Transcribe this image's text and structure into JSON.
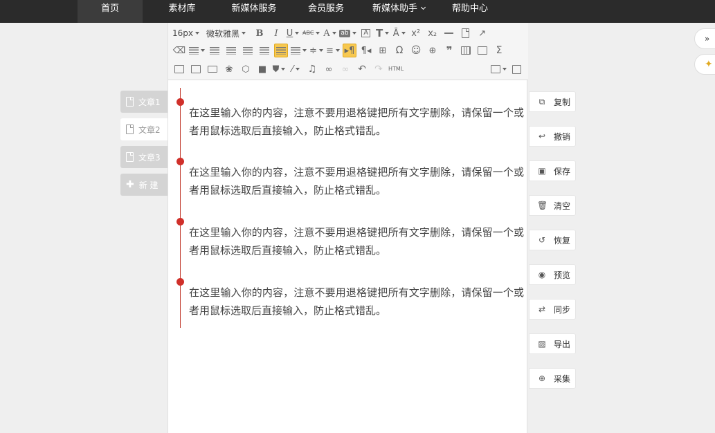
{
  "nav": {
    "items": [
      {
        "label": "首页",
        "active": true
      },
      {
        "label": "素材库"
      },
      {
        "label": "新媒体服务"
      },
      {
        "label": "会员服务"
      },
      {
        "label": "新媒体助手",
        "has_dropdown": true
      },
      {
        "label": "帮助中心"
      }
    ]
  },
  "toolbar": {
    "font_size": "16px",
    "font_family": "微软雅黑",
    "bold": "B",
    "italic": "I",
    "underline": "U",
    "strike": "ABC",
    "font_color": "A",
    "highlight": "ab",
    "html": "HTML"
  },
  "articles": [
    {
      "label": "文章1"
    },
    {
      "label": "文章2",
      "active": true
    },
    {
      "label": "文章3"
    }
  ],
  "new_label": "新 建",
  "content": {
    "paragraphs": [
      "在这里输入你的内容，注意不要用退格键把所有文字删除，请保留一个或者用鼠标选取后直接输入，防止格式错乱。",
      "在这里输入你的内容，注意不要用退格键把所有文字删除，请保留一个或者用鼠标选取后直接输入，防止格式错乱。",
      "在这里输入你的内容，注意不要用退格键把所有文字删除，请保留一个或者用鼠标选取后直接输入，防止格式错乱。",
      "在这里输入你的内容，注意不要用退格键把所有文字删除，请保留一个或者用鼠标选取后直接输入，防止格式错乱。"
    ]
  },
  "actions": [
    {
      "label": "复制",
      "icon": "copy-icon"
    },
    {
      "label": "撤销",
      "icon": "undo-icon"
    },
    {
      "label": "保存",
      "icon": "save-icon"
    },
    {
      "label": "清空",
      "icon": "trash-icon"
    },
    {
      "label": "恢复",
      "icon": "restore-icon"
    },
    {
      "label": "预览",
      "icon": "eye-icon"
    },
    {
      "label": "同步",
      "icon": "sync-icon"
    },
    {
      "label": "导出",
      "icon": "export-image-icon"
    },
    {
      "label": "采集",
      "icon": "zoom-in-icon"
    }
  ],
  "floating": {
    "expand": "»"
  },
  "colors": {
    "nav_bg": "#2b2b2b",
    "timeline": "#d0302a",
    "active_tool": "#f7c850"
  }
}
